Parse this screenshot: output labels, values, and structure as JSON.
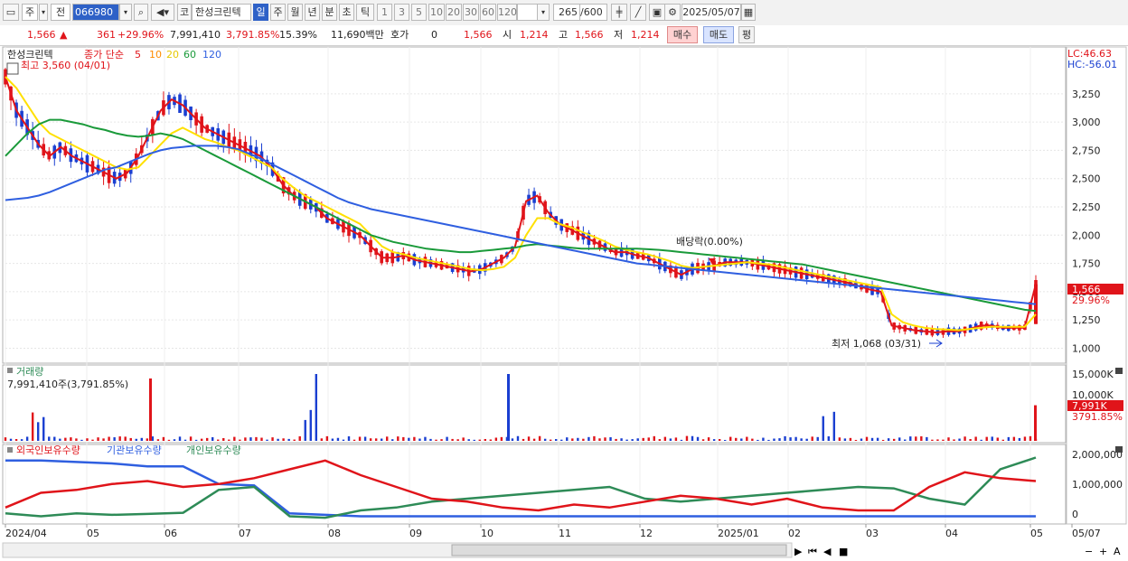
{
  "toolbar": {
    "stock_code": "066980",
    "type1": "주",
    "type2": "전",
    "stock_name_prefix": "코",
    "stock_name": "한성크린텍",
    "periods": [
      "일",
      "주",
      "월",
      "년",
      "분",
      "초",
      "틱"
    ],
    "selected_period": "일",
    "intervals": [
      "1",
      "3",
      "5",
      "10",
      "20",
      "30",
      "60",
      "120"
    ],
    "count": "265",
    "count_total": "/600",
    "date": "2025/05/07"
  },
  "quote": {
    "price": "1,566",
    "change": "361",
    "change_pct": "+29.96%",
    "volume": "7,991,410",
    "volume_pct": "3,791.85%",
    "turnover_rate": "15.39%",
    "amount": "11,690백만",
    "hoga_label": "호가",
    "hoga_value": "0",
    "open_value": "1,566",
    "open_label": "시",
    "open": "1,214",
    "high_label": "고",
    "high": "1,566",
    "low_label": "저",
    "low": "1,214",
    "buy_label": "매수",
    "sell_label": "매도",
    "eval_label": "평"
  },
  "price_panel": {
    "stock_label": "한성크린텍",
    "ma_title": "종가 단순",
    "ma_periods": [
      "5",
      "10",
      "20",
      "60",
      "120"
    ],
    "ma_colors": [
      "#e0141a",
      "#ff8c00",
      "#ffe000",
      "#1a9a3a",
      "#2f5fe0"
    ],
    "high_note": "최고 3,560 (04/01)",
    "low_note": "최저 1,068 (03/31)",
    "dividend_note": "배당락(0.00%)",
    "lc": "LC:46.63",
    "hc": "HC:-56.01",
    "y_ticks": [
      "3,250",
      "3,000",
      "2,750",
      "2,500",
      "2,250",
      "2,000",
      "1,750",
      "1,500",
      "1,250",
      "1,000"
    ],
    "last_price_tag": "1,566",
    "last_pct_tag": "29.96%"
  },
  "volume_panel": {
    "title": "거래량",
    "value_note": "7,991,410주(3,791.85%)",
    "y_ticks": [
      "15,000K",
      "10,000K"
    ],
    "last_tag": "7,991K",
    "last_pct_tag": "3791.85%"
  },
  "holding_panel": {
    "legend": [
      "외국인보유수량",
      "기관보유수량",
      "개인보유수량"
    ],
    "legend_colors": [
      "#e0141a",
      "#2f5fe0",
      "#2e8b57"
    ],
    "y_ticks": [
      "2,000,000",
      "1,000,000",
      "0"
    ]
  },
  "x_axis": {
    "labels": [
      "2024/04",
      "05",
      "06",
      "07",
      "08",
      "09",
      "10",
      "11",
      "12",
      "2025/01",
      "02",
      "03",
      "04",
      "05",
      "05/07"
    ]
  },
  "chart_data": {
    "type": "line",
    "price_series": [
      {
        "name": "5",
        "values": [
          3400,
          3100,
          2950,
          2800,
          2700,
          2780,
          2700,
          2650,
          2600,
          2550,
          2500,
          2550,
          2700,
          2900,
          3100,
          3200,
          3150,
          3050,
          2950,
          2900,
          2850,
          2800,
          2750,
          2700,
          2600,
          2450,
          2350,
          2300,
          2250,
          2150,
          2100,
          2050,
          2000,
          1900,
          1800,
          1800,
          1820,
          1780,
          1760,
          1740,
          1720,
          1700,
          1680,
          1700,
          1750,
          1800,
          1900,
          2300,
          2350,
          2200,
          2100,
          2050,
          2000,
          1950,
          1900,
          1850,
          1850,
          1820,
          1800,
          1750,
          1700,
          1650,
          1700,
          1720,
          1730,
          1760,
          1760,
          1760,
          1740,
          1720,
          1700,
          1680,
          1660,
          1640,
          1620,
          1600,
          1580,
          1550,
          1520,
          1500,
          1200,
          1180,
          1160,
          1150,
          1140,
          1150,
          1150,
          1170,
          1200,
          1200,
          1180,
          1180,
          1180,
          1566
        ]
      },
      {
        "name": "20",
        "values": [
          3400,
          3300,
          3150,
          3000,
          2900,
          2850,
          2800,
          2750,
          2700,
          2650,
          2600,
          2580,
          2600,
          2700,
          2800,
          2900,
          2950,
          2900,
          2850,
          2820,
          2780,
          2750,
          2700,
          2650,
          2600,
          2500,
          2420,
          2350,
          2300,
          2250,
          2200,
          2150,
          2100,
          2000,
          1900,
          1850,
          1830,
          1800,
          1780,
          1760,
          1740,
          1720,
          1700,
          1690,
          1700,
          1720,
          1800,
          2000,
          2150,
          2150,
          2100,
          2070,
          2030,
          1990,
          1950,
          1900,
          1870,
          1850,
          1830,
          1800,
          1770,
          1730,
          1710,
          1720,
          1730,
          1740,
          1750,
          1760,
          1750,
          1740,
          1720,
          1700,
          1680,
          1660,
          1640,
          1620,
          1600,
          1580,
          1560,
          1540,
          1300,
          1230,
          1200,
          1180,
          1170,
          1165,
          1160,
          1170,
          1180,
          1190,
          1190,
          1190,
          1190,
          1300
        ]
      },
      {
        "name": "60",
        "values": [
          2700,
          2800,
          2900,
          2980,
          3020,
          3020,
          3000,
          2980,
          2950,
          2930,
          2900,
          2880,
          2870,
          2880,
          2900,
          2880,
          2850,
          2800,
          2750,
          2700,
          2650,
          2600,
          2550,
          2500,
          2450,
          2400,
          2350,
          2300,
          2250,
          2200,
          2150,
          2100,
          2050,
          2000,
          1970,
          1940,
          1920,
          1900,
          1880,
          1870,
          1860,
          1850,
          1850,
          1860,
          1870,
          1880,
          1890,
          1910,
          1920,
          1910,
          1900,
          1890,
          1880,
          1880,
          1880,
          1880,
          1880,
          1880,
          1875,
          1870,
          1860,
          1850,
          1840,
          1830,
          1820,
          1810,
          1800,
          1790,
          1780,
          1770,
          1760,
          1750,
          1740,
          1720,
          1700,
          1680,
          1660,
          1640,
          1620,
          1600,
          1580,
          1560,
          1540,
          1520,
          1500,
          1480,
          1460,
          1440,
          1420,
          1400,
          1380,
          1360,
          1340,
          1330
        ]
      },
      {
        "name": "120",
        "values": [
          2310,
          2320,
          2330,
          2350,
          2380,
          2420,
          2460,
          2500,
          2540,
          2580,
          2600,
          2640,
          2680,
          2720,
          2750,
          2770,
          2780,
          2790,
          2790,
          2790,
          2780,
          2760,
          2720,
          2680,
          2630,
          2580,
          2530,
          2480,
          2430,
          2380,
          2330,
          2290,
          2260,
          2230,
          2210,
          2190,
          2170,
          2150,
          2130,
          2110,
          2090,
          2070,
          2050,
          2030,
          2010,
          1990,
          1970,
          1950,
          1930,
          1910,
          1890,
          1870,
          1850,
          1830,
          1810,
          1790,
          1770,
          1750,
          1740,
          1730,
          1720,
          1710,
          1700,
          1690,
          1680,
          1670,
          1660,
          1650,
          1640,
          1630,
          1620,
          1610,
          1600,
          1590,
          1580,
          1570,
          1560,
          1550,
          1540,
          1530,
          1520,
          1510,
          1500,
          1490,
          1480,
          1470,
          1460,
          1450,
          1440,
          1430,
          1420,
          1410,
          1400,
          1390
        ]
      }
    ],
    "ylim": [
      900,
      3600
    ]
  }
}
